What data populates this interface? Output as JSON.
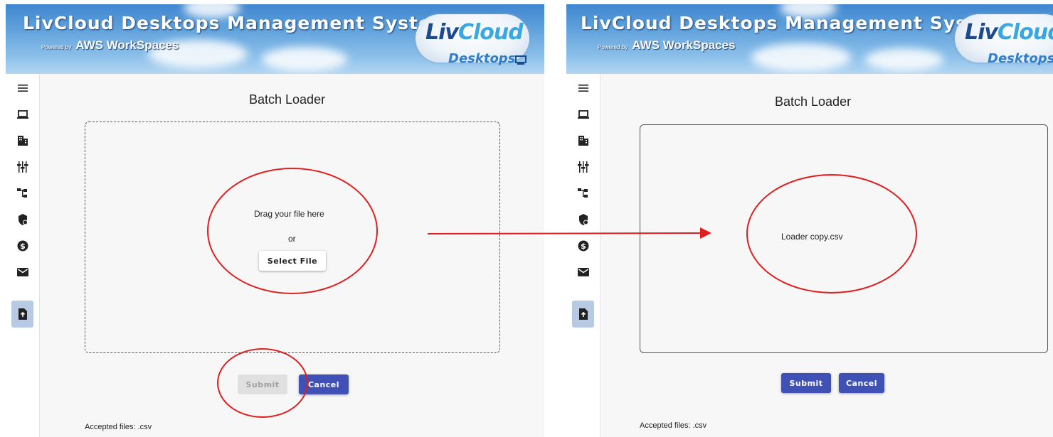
{
  "left_panel": {
    "header": {
      "title": "LivCloud Desktops Management System",
      "powered_by": "Powered by",
      "aws": "AWS WorkSpaces",
      "logo_liv": "Liv",
      "logo_cloud": "Cloud",
      "logo_desktops": "Desktops"
    },
    "nav": {
      "items": [
        "menu-icon",
        "laptop-icon",
        "building-icon",
        "sliders-icon",
        "hierarchy-icon",
        "security-shield-icon",
        "dollar-icon",
        "mail-icon",
        "file-upload-icon"
      ],
      "active_index": 8
    },
    "page_title": "Batch Loader",
    "dropzone": {
      "drag_text": "Drag your file here",
      "or_text": "or",
      "select_button": "Select File"
    },
    "submit_label": "Submit",
    "submit_state": "disabled",
    "cancel_label": "Cancel",
    "accepted_files": "Accepted files: .csv"
  },
  "right_panel": {
    "header": {
      "title": "LivCloud Desktops Management System",
      "powered_by": "Powered by",
      "aws": "AWS WorkSpaces",
      "logo_liv": "Liv",
      "logo_cloud": "Cloud",
      "logo_desktops": "Desktops"
    },
    "page_title": "Batch Loader",
    "dropzone": {
      "file_name": "Loader copy.csv"
    },
    "submit_label": "Submit",
    "submit_state": "enabled",
    "cancel_label": "Cancel",
    "accepted_files": "Accepted files: .csv"
  },
  "colors": {
    "primary_button": "#3f51b5",
    "disabled_button": "#e0e0e0",
    "annotation_red": "#e01e1e",
    "active_nav": "#b8c9e3"
  }
}
